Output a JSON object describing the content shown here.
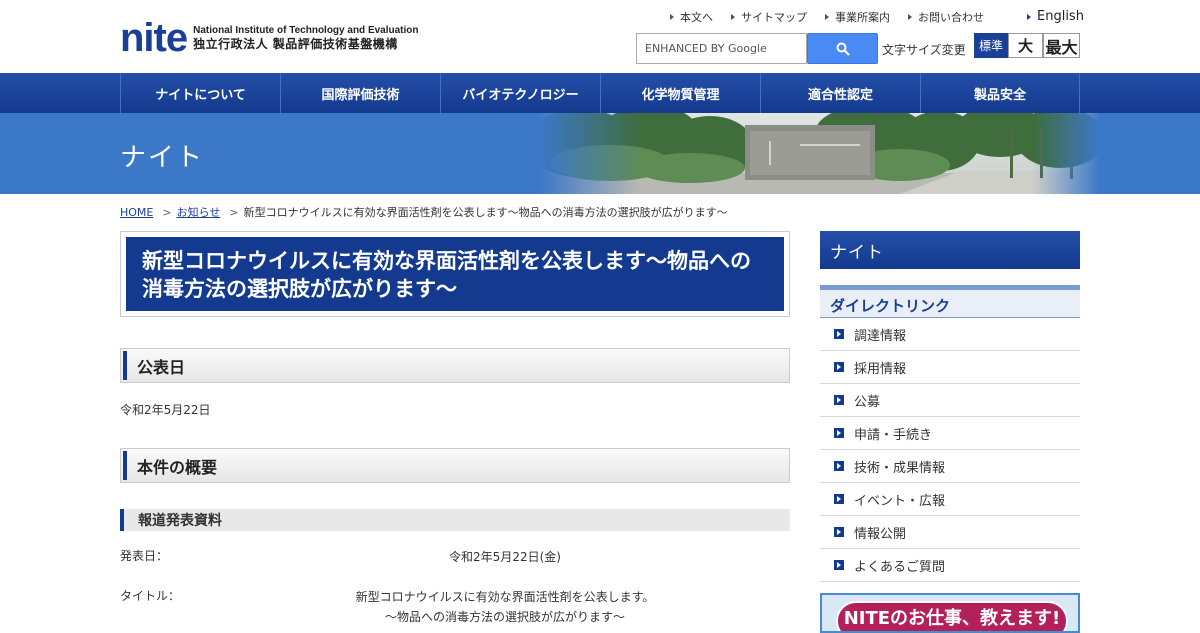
{
  "header": {
    "logo_mark": "nite",
    "logo_en": "National Institute of Technology and Evaluation",
    "logo_jp": "独立行政法人 製品評価技術基盤機構",
    "util_links": [
      "本文へ",
      "サイトマップ",
      "事業所案内",
      "お問い合わせ"
    ],
    "language": "English",
    "search_placeholder": "ENHANCED BY Google",
    "font_size_label": "文字サイズ変更",
    "font_size_options": [
      "標準",
      "大",
      "最大"
    ]
  },
  "nav": {
    "items": [
      "ナイトについて",
      "国際評価技術",
      "バイオテクノロジー",
      "化学物質管理",
      "適合性認定",
      "製品安全"
    ]
  },
  "banner": {
    "title": "ナイト"
  },
  "breadcrumb": {
    "home": "HOME",
    "news": "お知らせ",
    "current": "新型コロナウイルスに有効な界面活性剤を公表します～物品への消毒方法の選択肢が広がります～"
  },
  "main": {
    "title": "新型コロナウイルスに有効な界面活性剤を公表します～物品への消毒方法の選択肢が広がります～",
    "section_date_heading": "公表日",
    "date": "令和2年5月22日",
    "section_summary_heading": "本件の概要",
    "press_heading": "報道発表資料",
    "rows": [
      {
        "label": "発表日：",
        "value": "令和2年5月22日(金)",
        "value2": ""
      },
      {
        "label": "タイトル：",
        "value": "新型コロナウイルスに有効な界面活性剤を公表します。",
        "value2": "～物品への消毒方法の選択肢が広がります～"
      }
    ]
  },
  "sidebar": {
    "heading": "ナイト",
    "direct_link_heading": "ダイレクトリンク",
    "links": [
      "調達情報",
      "採用情報",
      "公募",
      "申請・手続き",
      "技術・成果情報",
      "イベント・広報",
      "情報公開",
      "よくあるご質問"
    ],
    "promo": "NITEのお仕事、教えます!"
  }
}
